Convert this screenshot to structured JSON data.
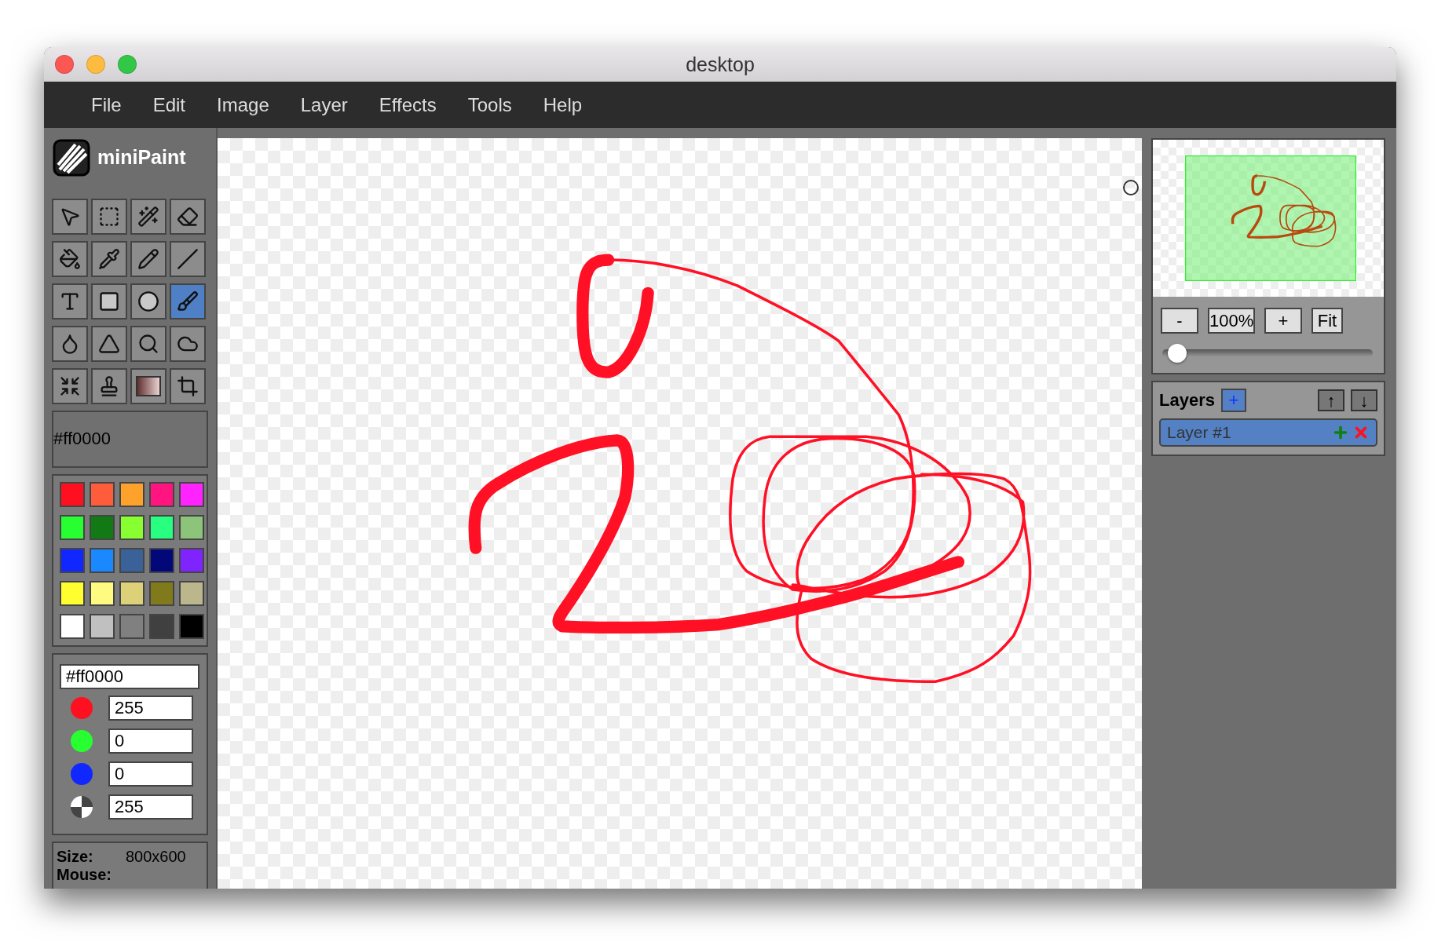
{
  "window": {
    "title": "desktop"
  },
  "menu": [
    "File",
    "Edit",
    "Image",
    "Layer",
    "Effects",
    "Tools",
    "Help"
  ],
  "app": {
    "name": "miniPaint"
  },
  "tools": [
    {
      "kind": "select",
      "selected": false
    },
    {
      "kind": "marquee",
      "selected": false
    },
    {
      "kind": "wand",
      "selected": false
    },
    {
      "kind": "eraser",
      "selected": false
    },
    {
      "kind": "fill",
      "selected": false
    },
    {
      "kind": "picker",
      "selected": false
    },
    {
      "kind": "pencil",
      "selected": false
    },
    {
      "kind": "line",
      "selected": false
    },
    {
      "kind": "text",
      "selected": false
    },
    {
      "kind": "rectangle",
      "selected": false
    },
    {
      "kind": "ellipse",
      "selected": false
    },
    {
      "kind": "brush",
      "selected": true
    },
    {
      "kind": "blur",
      "selected": false
    },
    {
      "kind": "sharpen",
      "selected": false
    },
    {
      "kind": "zoom",
      "selected": false
    },
    {
      "kind": "sponge",
      "selected": false
    },
    {
      "kind": "shrink",
      "selected": false
    },
    {
      "kind": "stamp",
      "selected": false
    },
    {
      "kind": "gradient",
      "selected": false
    },
    {
      "kind": "crop",
      "selected": false
    }
  ],
  "current_color": "#ff0000",
  "palette": [
    {
      "color": "#ff1020"
    },
    {
      "color": "#ff5c3c"
    },
    {
      "color": "#ffa22c"
    },
    {
      "color": "#ff1480"
    },
    {
      "color": "#ff24ff"
    },
    {
      "color": "#28ff30"
    },
    {
      "color": "#127a14"
    },
    {
      "color": "#88ff30"
    },
    {
      "color": "#28ff80"
    },
    {
      "color": "#8cc47a"
    },
    {
      "color": "#1028ff"
    },
    {
      "color": "#1a88ff"
    },
    {
      "color": "#3a6298"
    },
    {
      "color": "#02087a"
    },
    {
      "color": "#8024ff"
    },
    {
      "color": "#ffff30"
    },
    {
      "color": "#fffa80"
    },
    {
      "color": "#dcd078"
    },
    {
      "color": "#807a1c"
    },
    {
      "color": "#bcb68c"
    },
    {
      "color": "#ffffff"
    },
    {
      "color": "#c0c0c0"
    },
    {
      "color": "#808080"
    },
    {
      "color": "#404040"
    },
    {
      "color": "#000000"
    }
  ],
  "color_editor": {
    "hex": "#ff0000",
    "channels": [
      {
        "kind": "color",
        "color": "#ff1020",
        "value": "255"
      },
      {
        "kind": "color",
        "color": "#28ff30",
        "value": "0"
      },
      {
        "kind": "color",
        "color": "#1028ff",
        "value": "0"
      },
      {
        "kind": "alpha",
        "value": "255"
      }
    ]
  },
  "info": [
    {
      "label": "Size:",
      "value": "800x600"
    },
    {
      "label": "Mouse:"
    }
  ],
  "navigator": {
    "buttons": [
      "-",
      "100%",
      "+",
      "Fit"
    ],
    "zoom": {
      "level": 0.04
    }
  },
  "layers": {
    "title": "Layers",
    "add": "+",
    "up": "↑",
    "down": "↓",
    "items": [
      {
        "name": "Layer #1",
        "selected": true
      }
    ]
  }
}
